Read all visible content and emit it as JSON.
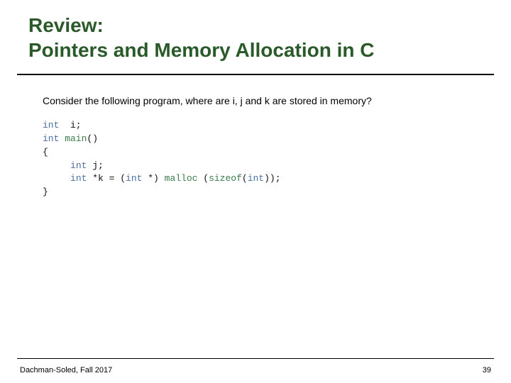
{
  "title": {
    "line1": "Review:",
    "line2": "Pointers and Memory Allocation in C"
  },
  "prompt": "Consider the following program, where are i, j and k are stored in memory?",
  "code": {
    "l1_kw": "int",
    "l1_rest": "  i;",
    "l2_kw": "int",
    "l2_fn": " main",
    "l2_rest": "()",
    "l3": "{",
    "l4_indent": "     ",
    "l4_kw": "int",
    "l4_rest": " j;",
    "l5_indent": "     ",
    "l5_kw": "int",
    "l5_mid": " *k = (",
    "l5_kw2": "int",
    "l5_mid2": " *) ",
    "l5_fn": "malloc",
    "l5_mid3": " (",
    "l5_fn2": "sizeof",
    "l5_mid4": "(",
    "l5_kw3": "int",
    "l5_rest": "));",
    "l6": "}"
  },
  "footer": {
    "left": "Dachman-Soled, Fall 2017",
    "page": "39"
  }
}
